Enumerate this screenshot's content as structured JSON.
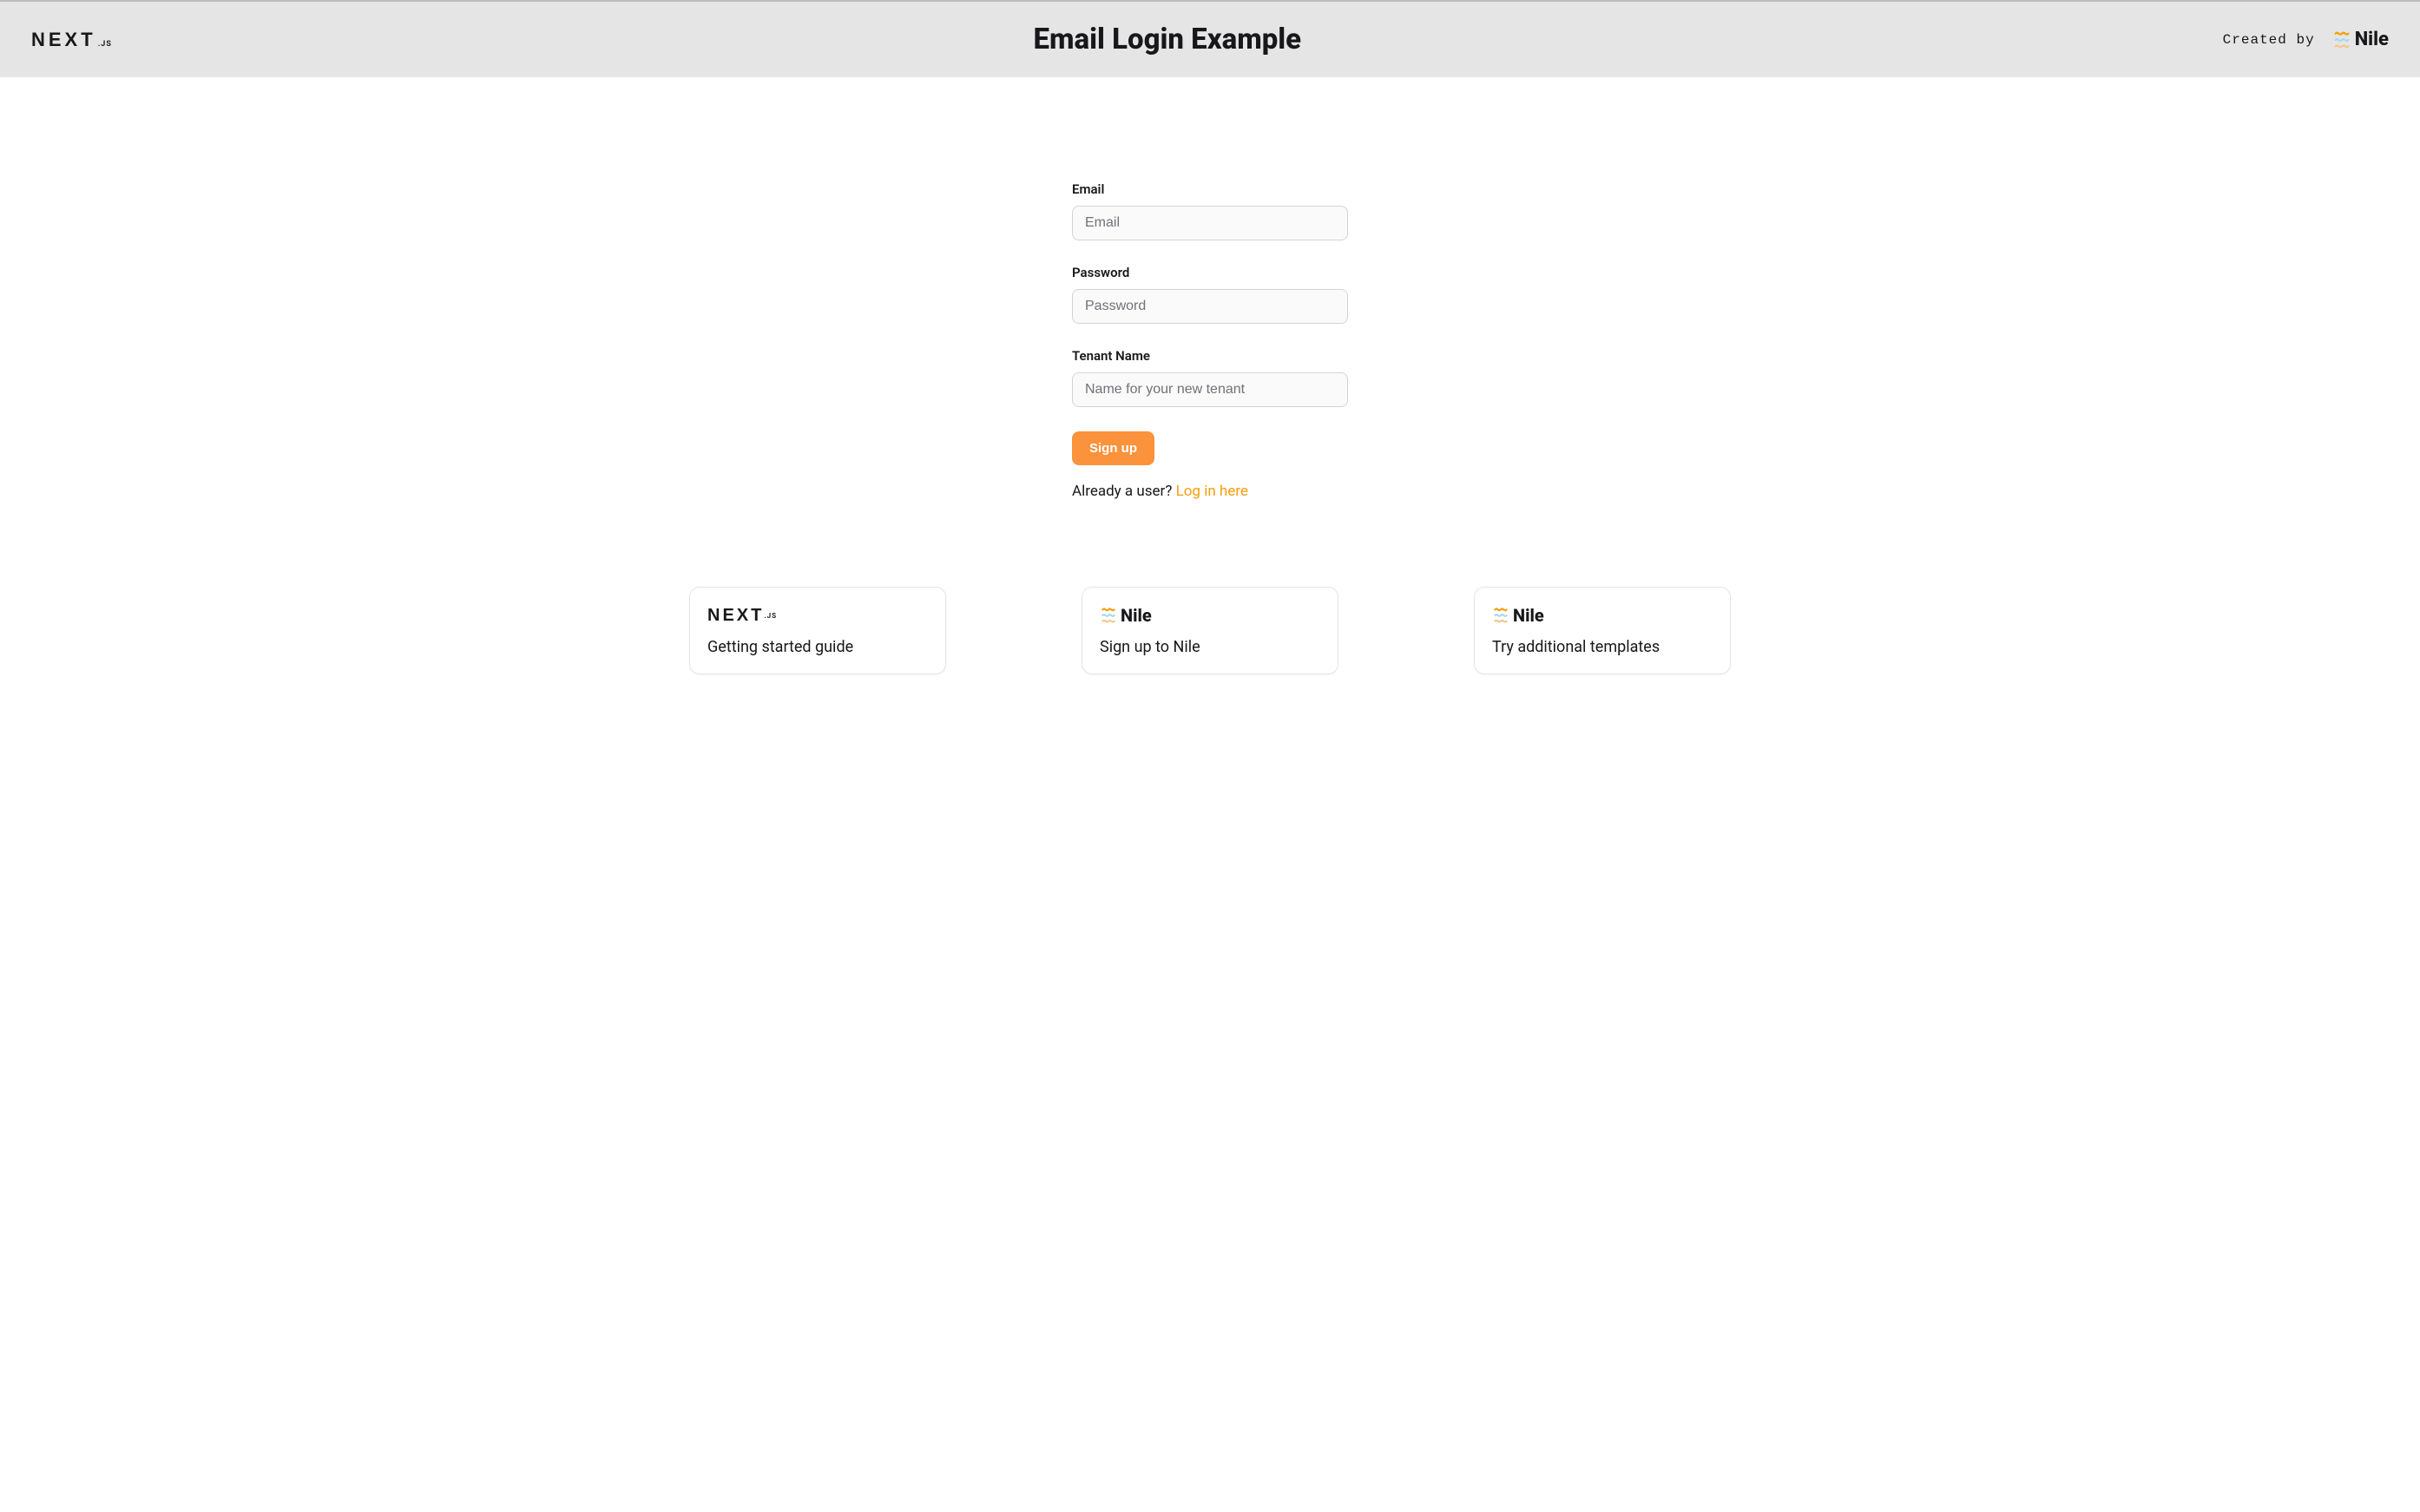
{
  "header": {
    "title": "Email Login Example",
    "createdBy": "Created by",
    "nextjs": {
      "main": "NEXT",
      "suffix": ".JS"
    },
    "nile": "Nile"
  },
  "form": {
    "email": {
      "label": "Email",
      "placeholder": "Email"
    },
    "password": {
      "label": "Password",
      "placeholder": "Password"
    },
    "tenant": {
      "label": "Tenant Name",
      "placeholder": "Name for your new tenant"
    },
    "submitLabel": "Sign up",
    "loginPrompt": "Already a user? ",
    "loginLink": "Log in here"
  },
  "cards": [
    {
      "logo": "nextjs",
      "text": "Getting started guide"
    },
    {
      "logo": "nile",
      "text": "Sign up to Nile"
    },
    {
      "logo": "nile",
      "text": "Try additional templates"
    }
  ]
}
